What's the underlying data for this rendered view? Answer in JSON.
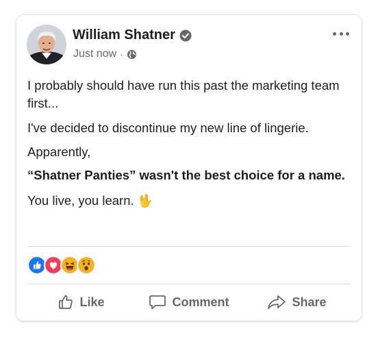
{
  "post": {
    "author": "William Shatner",
    "timestamp": "Just now",
    "meta_separator": "·",
    "privacy_icon": "globe-icon",
    "verified_icon": "verified-badge-icon",
    "paragraphs": {
      "p1": "I probably should have run this past the marketing team first...",
      "p2": "I've decided to discontinue my new line of lingerie.",
      "p3": "Apparently,",
      "p4": "“Shatner Panties” wasn't the best choice for a name.",
      "p5": "You live, you learn."
    },
    "p5_emoji": "🖖",
    "reactions": [
      "like-reaction-icon",
      "love-reaction-icon",
      "haha-reaction-icon",
      "wow-reaction-icon"
    ],
    "actions": {
      "like": "Like",
      "comment": "Comment",
      "share": "Share"
    }
  },
  "colors": {
    "like_blue": "#1877f2",
    "love_red": "#f33e58",
    "reaction_yellow": "#f7b125",
    "secondary_text": "#65676b",
    "divider": "#dadde1"
  }
}
